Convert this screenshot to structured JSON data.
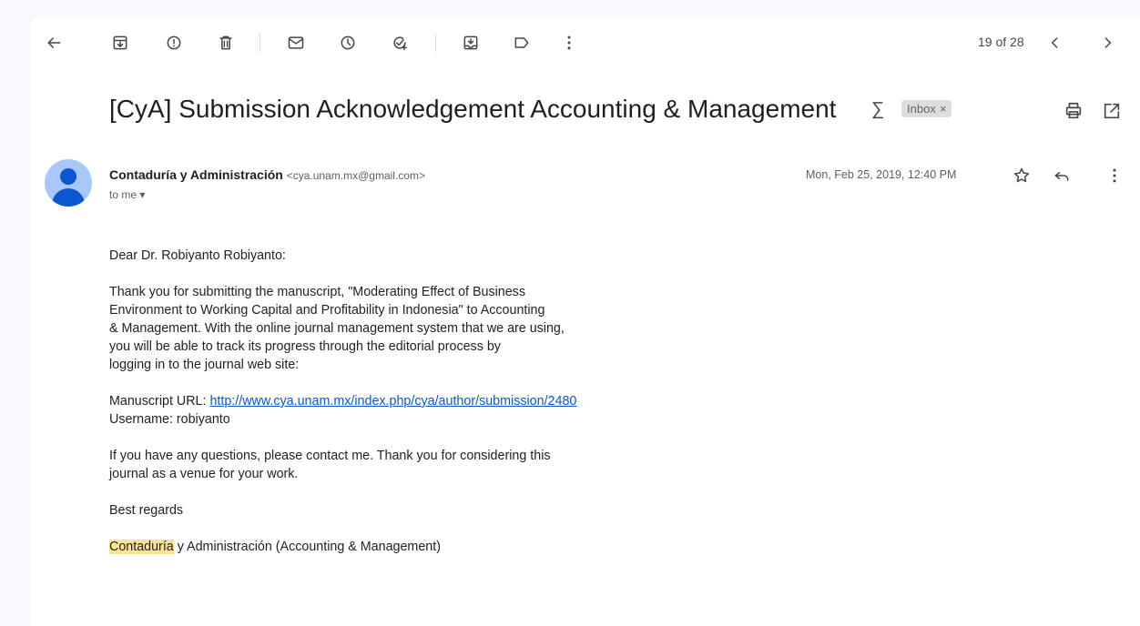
{
  "toolbar": {
    "icons": [
      "back-arrow-icon",
      "archive-icon",
      "report-spam-icon",
      "delete-icon",
      "mark-unread-icon",
      "snooze-icon",
      "add-to-tasks-icon",
      "move-to-icon",
      "label-icon",
      "more-vert-icon"
    ],
    "pager": "19 of 28"
  },
  "email": {
    "subject": "[CyA] Submission Acknowledgement Accounting & Management",
    "label_badge": "Inbox",
    "label_remove": "×",
    "sender_name": "Contaduría y Administración",
    "sender_email": "<cya.unam.mx@gmail.com>",
    "recipient": "to me",
    "date": "Mon, Feb 25, 2019, 12:40 PM",
    "body": {
      "greeting": "Dear Dr. Robiyanto Robiyanto:",
      "para1_lines": [
        "Thank you for submitting the manuscript, \"Moderating Effect of Business",
        "Environment to Working Capital and Profitability in Indonesia\" to Accounting",
        "& Management. With the online journal management system that we are using,",
        "you will be able to track its progress through the editorial process by",
        "logging in to the journal web site:"
      ],
      "url_label": "Manuscript URL: ",
      "url": "http://www.cya.unam.mx/index.php/cya/author/submission/2480",
      "username": "Username: robiyanto",
      "para3_lines": [
        "If you have any questions, please contact me. Thank you for considering this",
        "journal as a venue for your work."
      ],
      "closing": "Best regards",
      "signature_highlight": "Contaduría",
      "signature_rest": " y Administración (Accounting & Management)"
    }
  },
  "colors": {
    "background": "#f6f8fc",
    "link": "#1155cc",
    "highlight": "#fde293",
    "avatar_bg": "#a8c7fa",
    "avatar_fg": "#0b57d0"
  }
}
